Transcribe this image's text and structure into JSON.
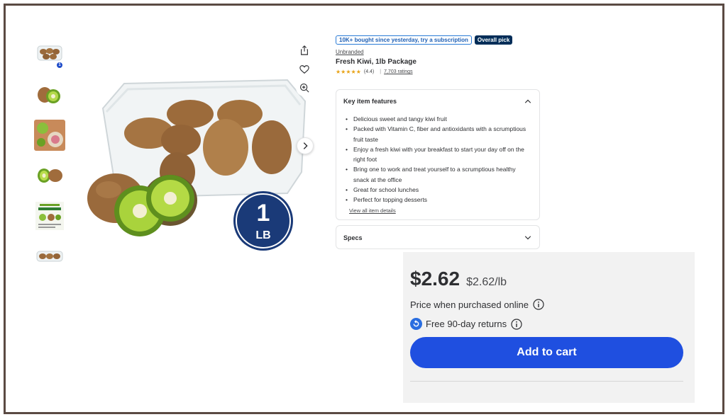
{
  "thumbnails": [
    {
      "name": "thumb-package-overhead",
      "badge": "1"
    },
    {
      "name": "thumb-kiwi-halves"
    },
    {
      "name": "thumb-kiwi-dish"
    },
    {
      "name": "thumb-kiwi-sliced"
    },
    {
      "name": "thumb-green-kiwi-info"
    },
    {
      "name": "thumb-package-side"
    }
  ],
  "main_image": {
    "badge_number": "1",
    "badge_unit": "LB"
  },
  "product": {
    "tag_subscription": "10K+ bought since yesterday, try a subscription",
    "tag_pick": "Overall pick",
    "brand": "Unbranded",
    "title": "Fresh Kiwi, 1lb Package",
    "stars": "★★★★★",
    "rating": "(4.4)",
    "rating_separator": "|",
    "ratings_count": "7,703 ratings"
  },
  "features": {
    "heading": "Key item features",
    "items": [
      "Delicious sweet and tangy kiwi fruit",
      "Packed with Vitamin C, fiber and antioxidants with a scrumptious fruit taste",
      "Enjoy a fresh kiwi with your breakfast to start your day off on the right foot",
      "Bring one to work and treat yourself to a scrumptious healthy snack at the office",
      "Great for school lunches",
      "Perfect for topping desserts"
    ],
    "view_all": "View all item details"
  },
  "specs": {
    "heading": "Specs"
  },
  "buybox": {
    "price": "$2.62",
    "unit_price": "$2.62/lb",
    "online_text": "Price when purchased online",
    "returns_text": "Free 90-day returns",
    "add_to_cart": "Add to cart"
  },
  "colors": {
    "accent": "#1f4fe0",
    "pick_tag": "#002d58",
    "star": "#e8a317",
    "frame": "#5a4a43"
  }
}
